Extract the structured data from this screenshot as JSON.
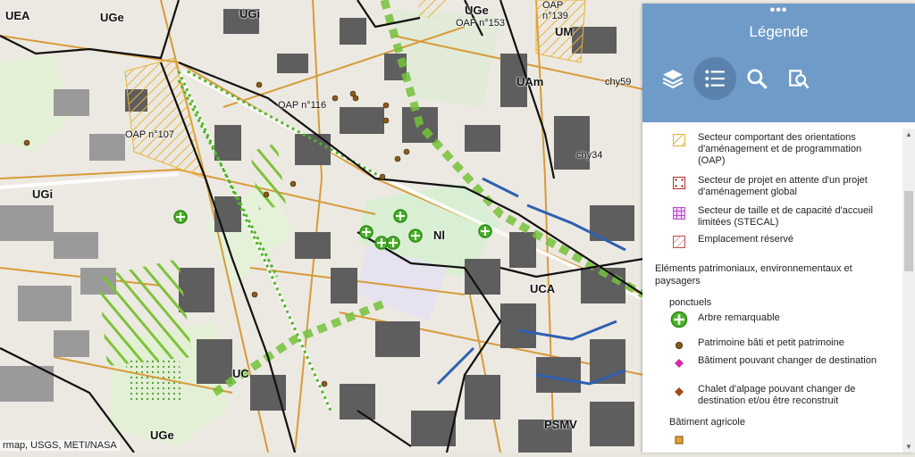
{
  "map": {
    "zones": {
      "uea": "UEA",
      "uge_top": "UGe",
      "ugi_top": "UGi",
      "uge_right": "UGe",
      "oap139": "OAP\nn°139",
      "um": "UM",
      "oap153": "OAP n°153",
      "uam": "UAm",
      "chy59": "chy59",
      "oap116": "OAP n°116",
      "oap107": "OAP n°107",
      "ugi_left": "UGi",
      "chy34": "chy34",
      "ni": "Nl",
      "uca": "UCA",
      "uc": "UC",
      "psmv": "PSMV",
      "uge_bottom": "UGe"
    },
    "attribution": "rmap, USGS, METI/NASA"
  },
  "panel": {
    "title": "Légende",
    "tools": {
      "layers": "layers-icon",
      "legend": "legend-list-icon",
      "search": "search-icon",
      "query": "query-icon"
    },
    "legend": {
      "oap": "Secteur comportant des orientations d'aménagement et de programmation (OAP)",
      "attente": "Secteur de projet en attente d'un projet d'aménagement global",
      "stecal": "Secteur de taille et de capacité d'accueil limitées (STECAL)",
      "er": "Emplacement réservé",
      "patrimoine_header": "Eléments patrimoniaux, environnementaux et paysagers",
      "ponctuels": "ponctuels",
      "arbre": "Arbre remarquable",
      "bati": "Patrimoine bâti et petit patrimoine",
      "batiment_dest": "Bâtiment pouvant changer de destination",
      "chalet": "Chalet d'alpage pouvant changer de destination et/ou être reconstruit",
      "agricole": "Bâtiment agricole"
    }
  },
  "colors": {
    "header": "#6f9bc8",
    "tool_active": "#5a82ac",
    "oap": "#e8b23a",
    "attente": "#b02a2a",
    "stecal": "#b84cc8",
    "er": "#c24a4a",
    "arbre": "#4ab12a",
    "bati": "#8a5a1a",
    "batiment_dest": "#d42aa6",
    "chalet": "#a4481e",
    "agricole": "#e2a23a"
  }
}
